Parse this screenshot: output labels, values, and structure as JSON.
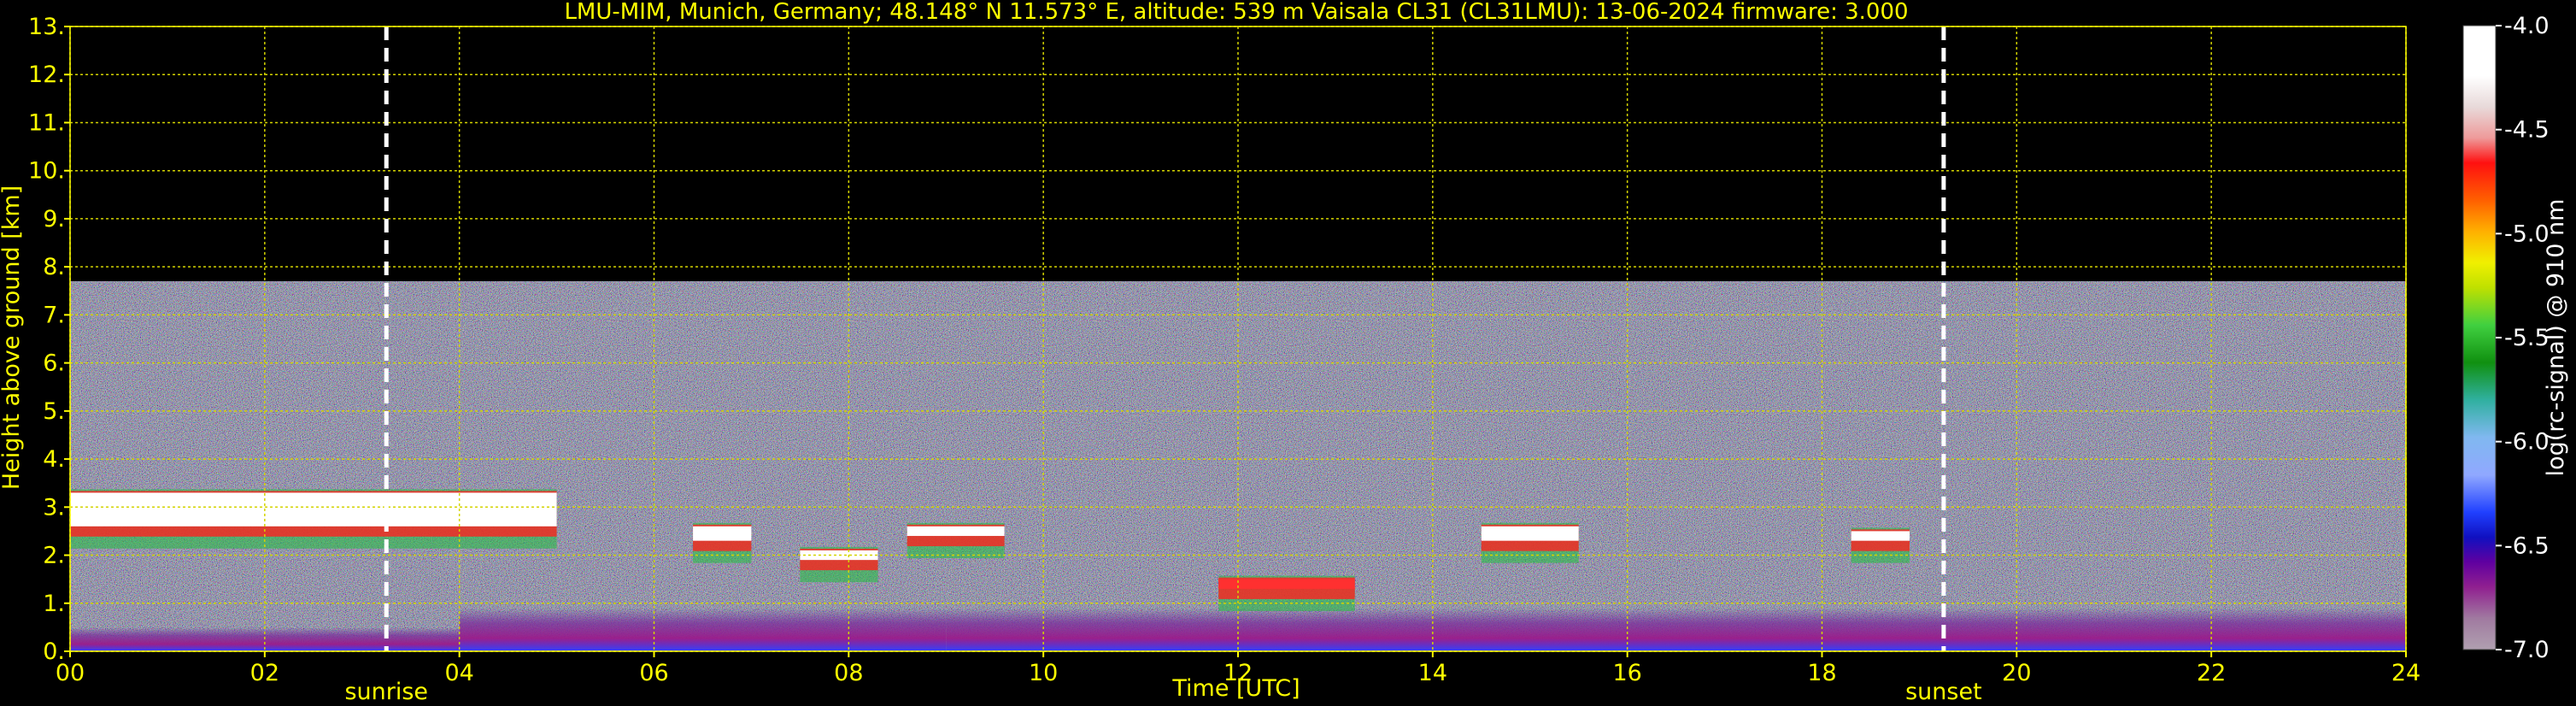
{
  "chart_data": {
    "type": "heatmap",
    "title": "LMU-MIM, Munich, Germany; 48.148° N 11.573° E, altitude: 539 m    Vaisala CL31 (CL31LMU): 13-06-2024    firmware: 3.000",
    "xlabel": "Time [UTC]",
    "ylabel": "Height above ground [km]",
    "colorbar_label": "log(rc-signal) @ 910 nm",
    "xlim": [
      0,
      24
    ],
    "ylim": [
      0,
      13
    ],
    "x_ticks": [
      "00",
      "02",
      "04",
      "06",
      "08",
      "10",
      "12",
      "14",
      "16",
      "18",
      "20",
      "22",
      "24"
    ],
    "y_ticks": [
      "0.",
      "1.",
      "2.",
      "3.",
      "4.",
      "5.",
      "6.",
      "7.",
      "8.",
      "9.",
      "10.",
      "11.",
      "12.",
      "13."
    ],
    "colorbar_ticks": [
      "-4.0",
      "-4.5",
      "-5.0",
      "-5.5",
      "-6.0",
      "-6.5",
      "-7.0"
    ],
    "colorbar_range": [
      -7.0,
      -4.0
    ],
    "grid": true,
    "vertical_markers": [
      {
        "label": "sunrise",
        "time": 3.25
      },
      {
        "label": "sunset",
        "time": 19.25
      }
    ],
    "features": {
      "noise_top_km": 7.7,
      "cloud_layers": [
        {
          "t_start": 0.0,
          "t_end": 5.0,
          "base_km": 2.6,
          "top_km": 3.3,
          "level": -4.2
        },
        {
          "t_start": 6.4,
          "t_end": 7.0,
          "base_km": 2.3,
          "top_km": 2.6,
          "level": -4.3
        },
        {
          "t_start": 7.5,
          "t_end": 8.3,
          "base_km": 1.9,
          "top_km": 2.1,
          "level": -4.3
        },
        {
          "t_start": 8.6,
          "t_end": 9.6,
          "base_km": 2.4,
          "top_km": 2.6,
          "level": -4.2
        },
        {
          "t_start": 11.8,
          "t_end": 13.2,
          "base_km": 1.3,
          "top_km": 1.5,
          "level": -4.4
        },
        {
          "t_start": 14.5,
          "t_end": 15.5,
          "base_km": 2.3,
          "top_km": 2.6,
          "level": -4.3
        },
        {
          "t_start": 18.3,
          "t_end": 18.9,
          "base_km": 2.3,
          "top_km": 2.5,
          "level": -4.2
        }
      ],
      "boundary_layer": [
        {
          "t_start": 0.0,
          "t_end": 4.0,
          "top_km": 0.5
        },
        {
          "t_start": 4.0,
          "t_end": 9.0,
          "top_km": 0.9
        },
        {
          "t_start": 9.0,
          "t_end": 24.0,
          "top_km": 0.9
        }
      ]
    }
  }
}
